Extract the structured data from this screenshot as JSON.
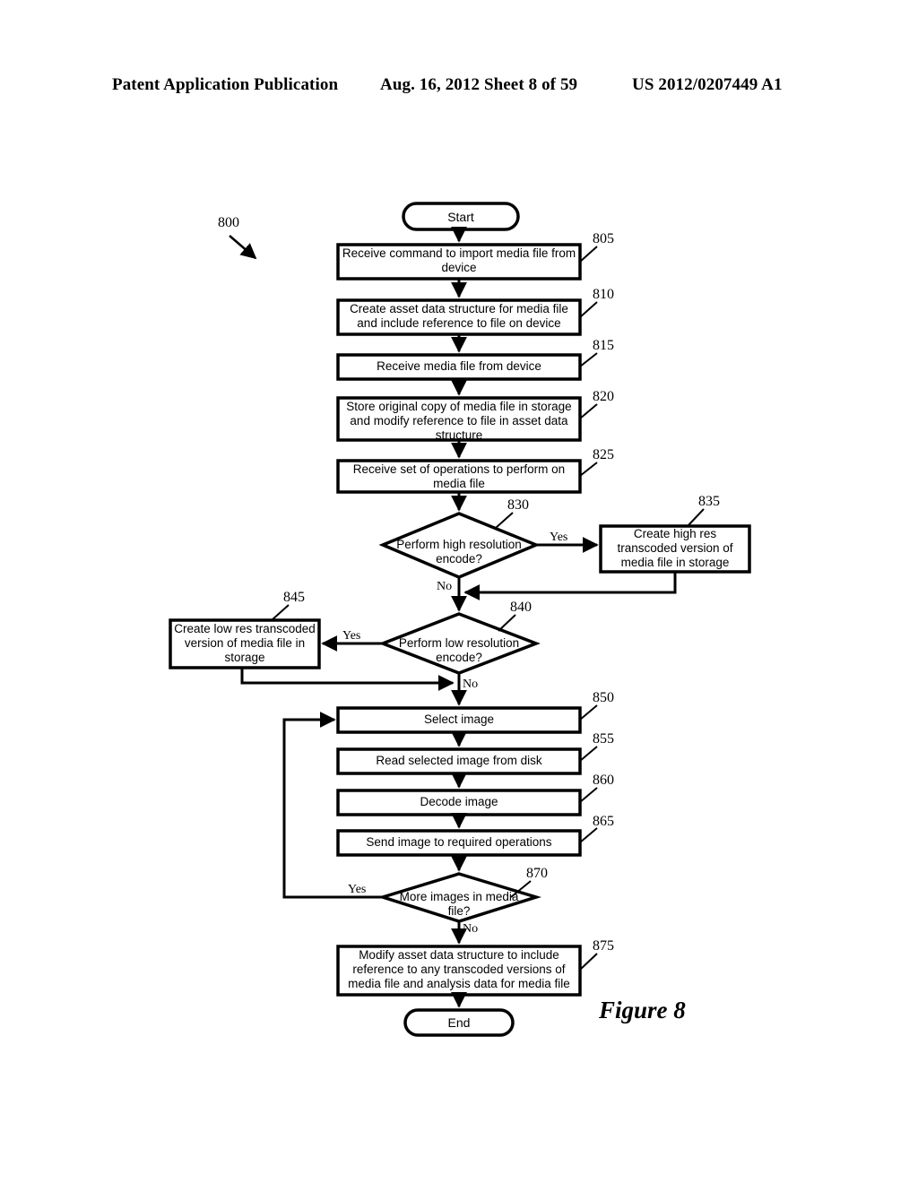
{
  "header": {
    "left": "Patent Application Publication",
    "middle": "Aug. 16, 2012  Sheet 8 of 59",
    "right": "US 2012/0207449 A1"
  },
  "figure": {
    "caption": "Figure 8",
    "diagram_ref": "800",
    "type": "flowchart"
  },
  "nodes": {
    "start": {
      "ref": "",
      "text": "Start",
      "shape": "terminator"
    },
    "n805": {
      "ref": "805",
      "text": "Receive command to import media file from device",
      "shape": "process"
    },
    "n810": {
      "ref": "810",
      "text": "Create asset data structure for media file and include reference to file on device",
      "shape": "process"
    },
    "n815": {
      "ref": "815",
      "text": "Receive media file from device",
      "shape": "process"
    },
    "n820": {
      "ref": "820",
      "text": "Store original copy of media file in storage and modify reference to file in asset data structure",
      "shape": "process"
    },
    "n825": {
      "ref": "825",
      "text": "Receive set of operations to perform on media file",
      "shape": "process"
    },
    "n830": {
      "ref": "830",
      "text": "Perform high resolution encode?",
      "shape": "decision"
    },
    "n835": {
      "ref": "835",
      "text": "Create high res transcoded version of media file in storage",
      "shape": "process"
    },
    "n840": {
      "ref": "840",
      "text": "Perform low resolution encode?",
      "shape": "decision"
    },
    "n845": {
      "ref": "845",
      "text": "Create low res transcoded version of media file in storage",
      "shape": "process"
    },
    "n850": {
      "ref": "850",
      "text": "Select image",
      "shape": "process"
    },
    "n855": {
      "ref": "855",
      "text": "Read selected image from disk",
      "shape": "process"
    },
    "n860": {
      "ref": "860",
      "text": "Decode image",
      "shape": "process"
    },
    "n865": {
      "ref": "865",
      "text": "Send image to required operations",
      "shape": "process"
    },
    "n870": {
      "ref": "870",
      "text": "More images in media file?",
      "shape": "decision"
    },
    "n875": {
      "ref": "875",
      "text": "Modify asset data structure to include reference to any transcoded versions of media file and analysis data for media file",
      "shape": "process"
    },
    "end": {
      "ref": "",
      "text": "End",
      "shape": "terminator"
    }
  },
  "edge_labels": {
    "yes830": "Yes",
    "no830": "No",
    "yes840": "Yes",
    "no840": "No",
    "yes870": "Yes",
    "no870": "No"
  },
  "colors": {
    "stroke": "#000000",
    "fill": "#ffffff",
    "page": "#ffffff"
  }
}
